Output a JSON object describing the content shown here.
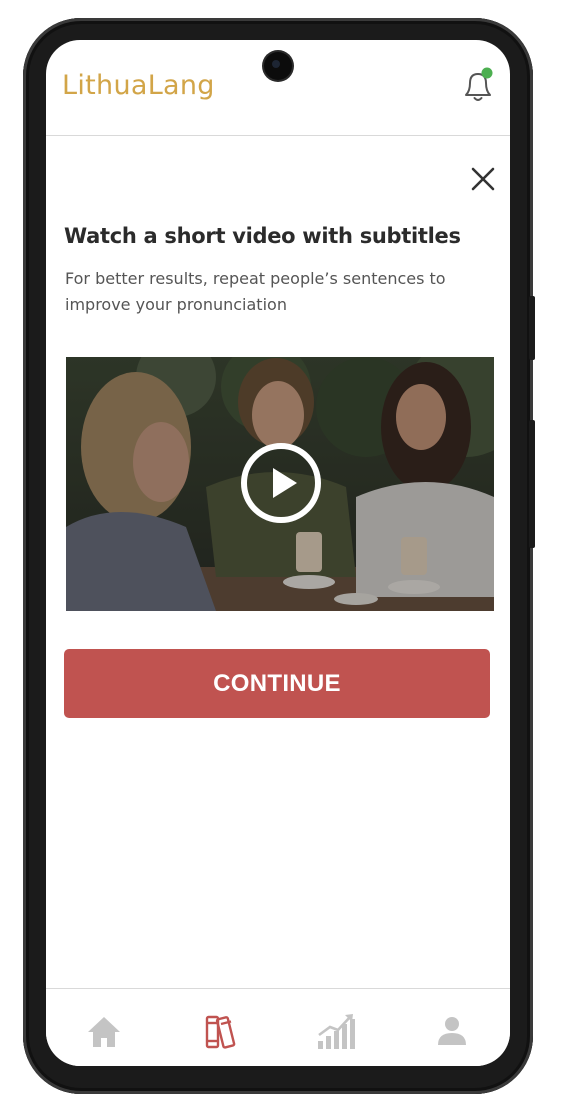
{
  "app": {
    "logo": "LithuaLang"
  },
  "header": {
    "bell_icon": "bell-icon",
    "notification_color": "#4caf50"
  },
  "lesson": {
    "title": "Watch a short video with subtitles",
    "subtitle": "For better results, repeat people’s sentences to improve your pronunciation",
    "close_icon": "close-icon",
    "video": {
      "play_icon": "play-icon",
      "description": "video thumbnail"
    }
  },
  "actions": {
    "continue_label": "CONTINUE",
    "continue_color": "#c05350"
  },
  "nav": {
    "items": [
      {
        "name": "home",
        "icon": "home-icon",
        "active": false
      },
      {
        "name": "library",
        "icon": "books-icon",
        "active": true
      },
      {
        "name": "progress",
        "icon": "chart-icon",
        "active": false
      },
      {
        "name": "profile",
        "icon": "user-icon",
        "active": false
      }
    ],
    "active_color": "#c05350",
    "inactive_color": "#c4c4c4"
  }
}
